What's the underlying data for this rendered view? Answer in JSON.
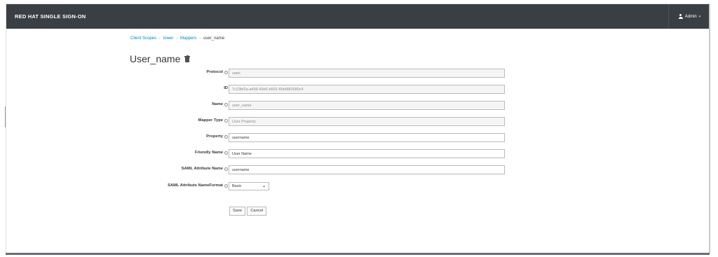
{
  "header": {
    "brand": "RED HAT SINGLE SIGN-ON",
    "user_label": "Admin"
  },
  "breadcrumb": [
    {
      "label": "Client Scopes"
    },
    {
      "label": "tower"
    },
    {
      "label": "Mappers"
    },
    {
      "label": "user_name"
    }
  ],
  "page": {
    "title": "User_name"
  },
  "form": {
    "protocol": {
      "label": "Protocol",
      "value": "saml"
    },
    "id": {
      "label": "ID",
      "value": "7c23bf2a-a499-49d5-b591-f5dd882680c4"
    },
    "name": {
      "label": "Name",
      "value": "user_name"
    },
    "mapper_type": {
      "label": "Mapper Type",
      "value": "User Property"
    },
    "property": {
      "label": "Property",
      "value": "username"
    },
    "friendly_name": {
      "label": "Friendly Name",
      "value": "User Name"
    },
    "saml_attribute_name": {
      "label": "SAML Attribute Name",
      "value": "username"
    },
    "saml_attribute_nameformat": {
      "label": "SAML Attribute NameFormat",
      "value": "Basic"
    }
  },
  "actions": {
    "save_label": "Save",
    "cancel_label": "Cancel"
  },
  "icons": {
    "user": "user-icon",
    "help": "help-icon",
    "trash": "trash-icon",
    "dropdown": "chevron-down-icon"
  }
}
